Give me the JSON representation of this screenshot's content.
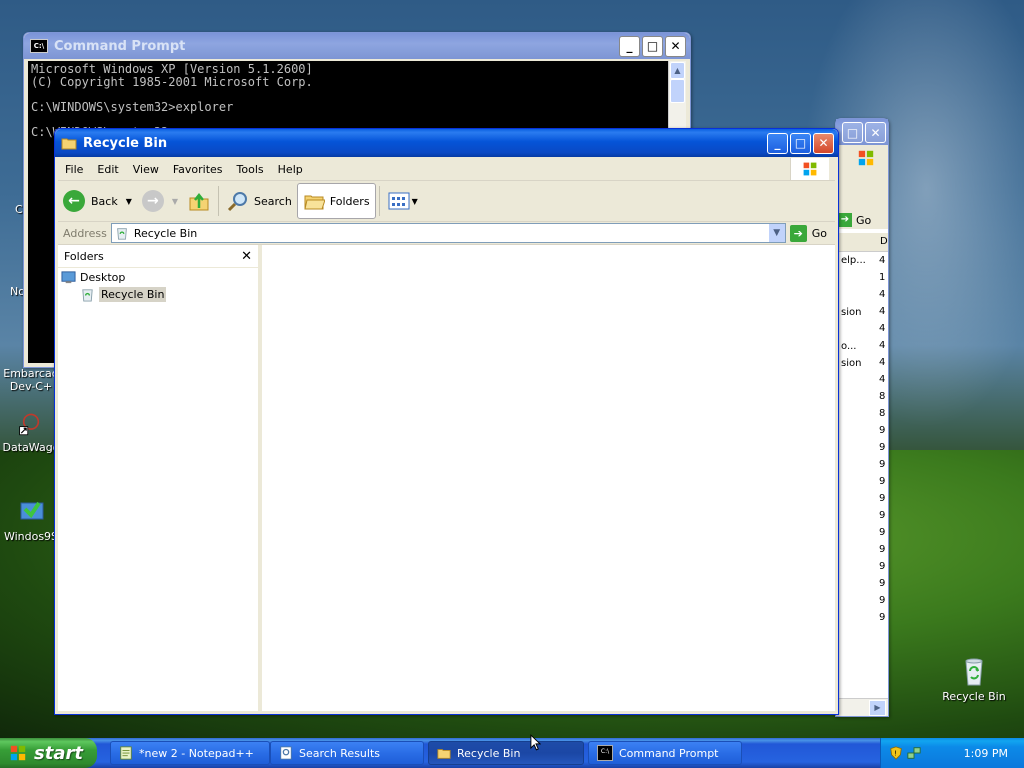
{
  "desktop": {
    "icons_left": [
      {
        "label": "Embarcad\nDev-C+",
        "top": 0
      },
      {
        "label": "DataWago",
        "top": 0
      },
      {
        "label": "Windos9S",
        "top": 0
      }
    ],
    "left_partial_labels": [
      "C",
      "No"
    ],
    "recycle_icon_label": "Recycle Bin"
  },
  "cmd": {
    "title": "Command Prompt",
    "lines": "Microsoft Windows XP [Version 5.1.2600]\n(C) Copyright 1985-2001 Microsoft Corp.\n\nC:\\WINDOWS\\system32>explorer\n\nC:\\WINDOWS\\system32>"
  },
  "back_window": {
    "go_label": "Go",
    "col_header": "D",
    "row_texts": [
      "elp...",
      "sion",
      "o...",
      "sion"
    ],
    "row_numbers": [
      "4",
      "1",
      "4",
      "4",
      "4",
      "4",
      "4",
      "4",
      "8",
      "8",
      "9",
      "9",
      "9",
      "9",
      "9",
      "9",
      "9",
      "9",
      "9",
      "9",
      "9",
      "9"
    ]
  },
  "explorer": {
    "title": "Recycle Bin",
    "menu": [
      "File",
      "Edit",
      "View",
      "Favorites",
      "Tools",
      "Help"
    ],
    "toolbar": {
      "back": "Back",
      "search": "Search",
      "folders": "Folders"
    },
    "address": {
      "label": "Address",
      "value": "Recycle Bin",
      "go": "Go"
    },
    "folders_pane": {
      "title": "Folders",
      "close": "✕",
      "tree": [
        {
          "label": "Desktop",
          "selected": false
        },
        {
          "label": "Recycle Bin",
          "selected": true
        }
      ]
    }
  },
  "taskbar": {
    "start": "start",
    "tasks": [
      {
        "label": "*new 2 - Notepad++",
        "active": false
      },
      {
        "label": "Search Results",
        "active": false
      },
      {
        "label": "Recycle Bin",
        "active": true
      },
      {
        "label": "Command Prompt",
        "active": false
      }
    ],
    "clock": "1:09 PM"
  },
  "colors": {
    "title_active": "#0554d8",
    "title_inactive": "#7d95d4",
    "start_green": "#379e37",
    "taskbar_blue": "#2663e0"
  }
}
